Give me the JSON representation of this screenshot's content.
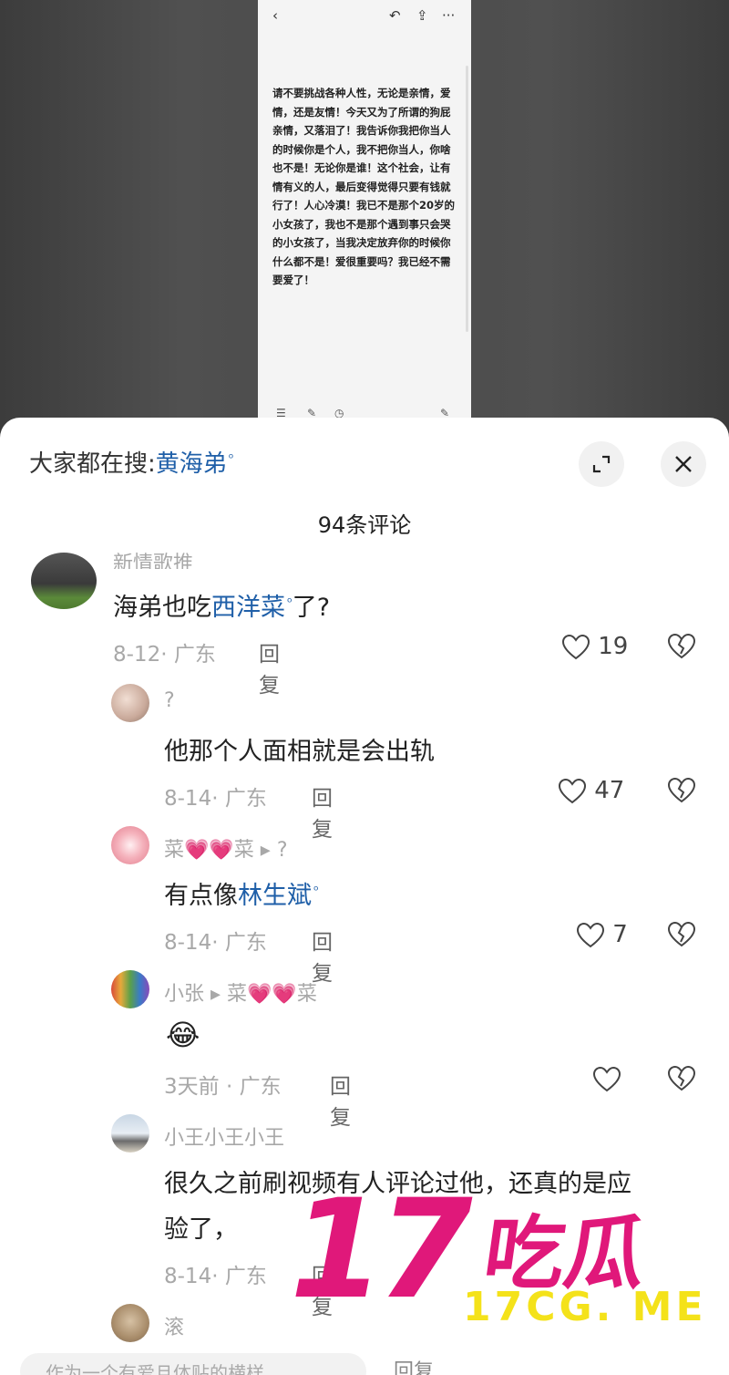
{
  "note": {
    "text": "请不要挑战各种人性，无论是亲情，爱情，还是友情！今天又为了所谓的狗屁亲情，又落泪了！我告诉你我把你当人的时候你是个人，我不把你当人，你啥也不是！无论你是谁！这个社会，让有情有义的人，最后变得觉得只要有钱就行了！人心冷漠！我已不是那个20岁的小女孩了，我也不是那个遇到事只会哭的小女孩了，当我决定放弃你的时候你什么都不是！爱很重要吗？我已经不需要爱了！"
  },
  "sheet": {
    "search_prefix": "大家都在搜:",
    "search_term": "黄海弟",
    "title": "94条评论"
  },
  "comments": [
    {
      "user": "新情歌推",
      "text": "海弟也吃",
      "link": "西洋菜",
      "suffix": "了?",
      "meta": "8-12· 广东",
      "reply": "回复",
      "likes": "19"
    },
    {
      "user": "?",
      "text": "他那个人面相就是会出轨",
      "meta": "8-14· 广东",
      "reply": "回复",
      "likes": "47"
    },
    {
      "user": "菜💗💗菜 ▸ ?",
      "text": "有点像",
      "link": "林生斌",
      "meta": "8-14· 广东",
      "reply": "回复",
      "likes": "7"
    },
    {
      "user": "小张 ▸ 菜💗💗菜",
      "text": "😂",
      "meta": "3天前 · 广东",
      "reply": "回复",
      "likes": ""
    },
    {
      "user": "小王小王小王",
      "text": "很久之前刷视频有人评论过他，还真的是应",
      "text2": "验了，",
      "meta": "8-14· 广东",
      "reply": "回复",
      "likes": ""
    },
    {
      "user": "滚"
    }
  ],
  "input": {
    "placeholder": "作为一个有爱且体贴的横样",
    "reply_label": "回复"
  },
  "watermark": {
    "big": "17",
    "cn": "吃瓜",
    "url": "17CG. ME"
  }
}
